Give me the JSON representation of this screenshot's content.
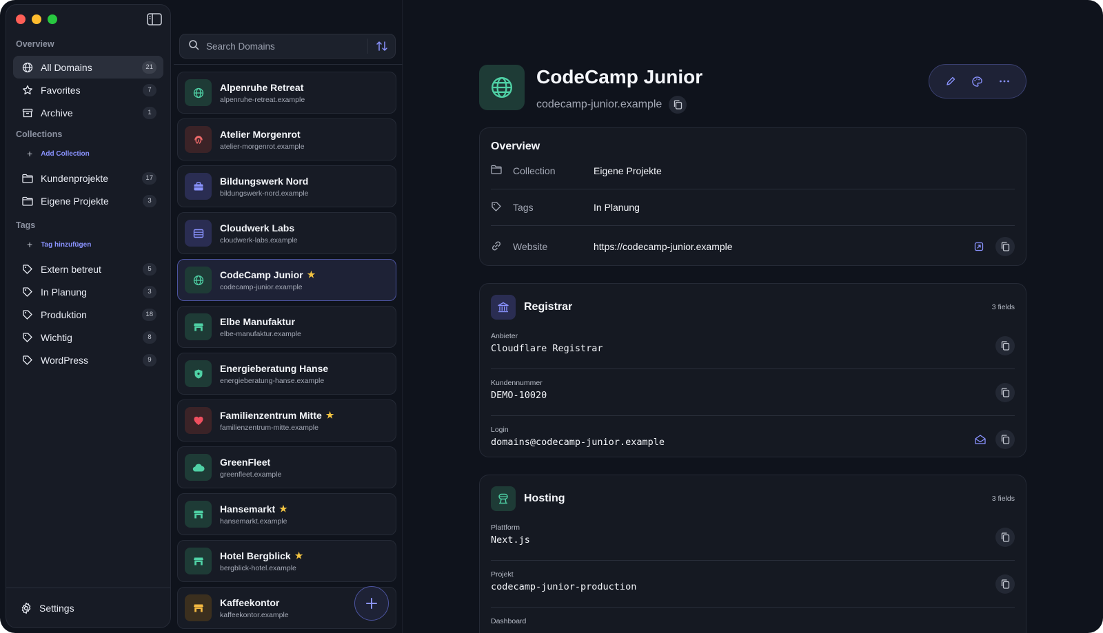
{
  "sidebar": {
    "overview_title": "Overview",
    "overview_items": [
      {
        "label": "All Domains",
        "count": "21",
        "icon": "globe-icon"
      },
      {
        "label": "Favorites",
        "count": "7",
        "icon": "star-icon"
      },
      {
        "label": "Archive",
        "count": "1",
        "icon": "archive-icon"
      }
    ],
    "collections_title": "Collections",
    "add_collection": "Add Collection",
    "collections": [
      {
        "label": "Kundenprojekte",
        "count": "17"
      },
      {
        "label": "Eigene Projekte",
        "count": "3"
      }
    ],
    "tags_title": "Tags",
    "add_tag": "Tag hinzufügen",
    "tags": [
      {
        "label": "Extern betreut",
        "count": "5"
      },
      {
        "label": "In Planung",
        "count": "3"
      },
      {
        "label": "Produktion",
        "count": "18"
      },
      {
        "label": "Wichtig",
        "count": "8"
      },
      {
        "label": "WordPress",
        "count": "9"
      }
    ],
    "settings_label": "Settings"
  },
  "search": {
    "placeholder": "Search Domains"
  },
  "domains": [
    {
      "name": "Alpenruhe Retreat",
      "domain": "alpenruhe-retreat.example",
      "icon": "globe-icon",
      "favorite": false
    },
    {
      "name": "Atelier Morgenrot",
      "domain": "atelier-morgenrot.example",
      "icon": "fingerprint-icon",
      "favorite": false
    },
    {
      "name": "Bildungswerk Nord",
      "domain": "bildungswerk-nord.example",
      "icon": "briefcase-icon",
      "favorite": false
    },
    {
      "name": "Cloudwerk Labs",
      "domain": "cloudwerk-labs.example",
      "icon": "server-icon",
      "favorite": false
    },
    {
      "name": "CodeCamp Junior",
      "domain": "codecamp-junior.example",
      "icon": "globe-icon",
      "favorite": true
    },
    {
      "name": "Elbe Manufaktur",
      "domain": "elbe-manufaktur.example",
      "icon": "store-icon",
      "favorite": false
    },
    {
      "name": "Energieberatung Hanse",
      "domain": "energieberatung-hanse.example",
      "icon": "shield-icon",
      "favorite": false
    },
    {
      "name": "Familienzentrum Mitte",
      "domain": "familienzentrum-mitte.example",
      "icon": "heart-icon",
      "favorite": true
    },
    {
      "name": "GreenFleet",
      "domain": "greenfleet.example",
      "icon": "cloud-icon",
      "favorite": false
    },
    {
      "name": "Hansemarkt",
      "domain": "hansemarkt.example",
      "icon": "store-icon",
      "favorite": true
    },
    {
      "name": "Hotel Bergblick",
      "domain": "bergblick-hotel.example",
      "icon": "store-icon",
      "favorite": true
    },
    {
      "name": "Kaffeekontor",
      "domain": "kaffeekontor.example",
      "icon": "store-icon",
      "favorite": false
    }
  ],
  "detail": {
    "title": "CodeCamp Junior",
    "domain": "codecamp-junior.example",
    "overview": {
      "heading": "Overview",
      "rows": [
        {
          "key": "Collection",
          "value": "Eigene Projekte"
        },
        {
          "key": "Tags",
          "value": "In Planung"
        },
        {
          "key": "Website",
          "value": "https://codecamp-junior.example"
        }
      ]
    },
    "registrar": {
      "heading": "Registrar",
      "count": "3 fields",
      "fields": [
        {
          "label": "Anbieter",
          "value": "Cloudflare Registrar"
        },
        {
          "label": "Kundennummer",
          "value": "DEMO-10020"
        },
        {
          "label": "Login",
          "value": "domains@codecamp-junior.example"
        }
      ]
    },
    "hosting": {
      "heading": "Hosting",
      "count": "3 fields",
      "fields": [
        {
          "label": "Plattform",
          "value": "Next.js"
        },
        {
          "label": "Projekt",
          "value": "codecamp-junior-production"
        },
        {
          "label": "Dashboard",
          "value": ""
        }
      ]
    }
  },
  "colors": {
    "accent": "#8a93ff",
    "background": "#0f131c",
    "star": "#f4c542",
    "green_icon": "#4fd1a5"
  }
}
